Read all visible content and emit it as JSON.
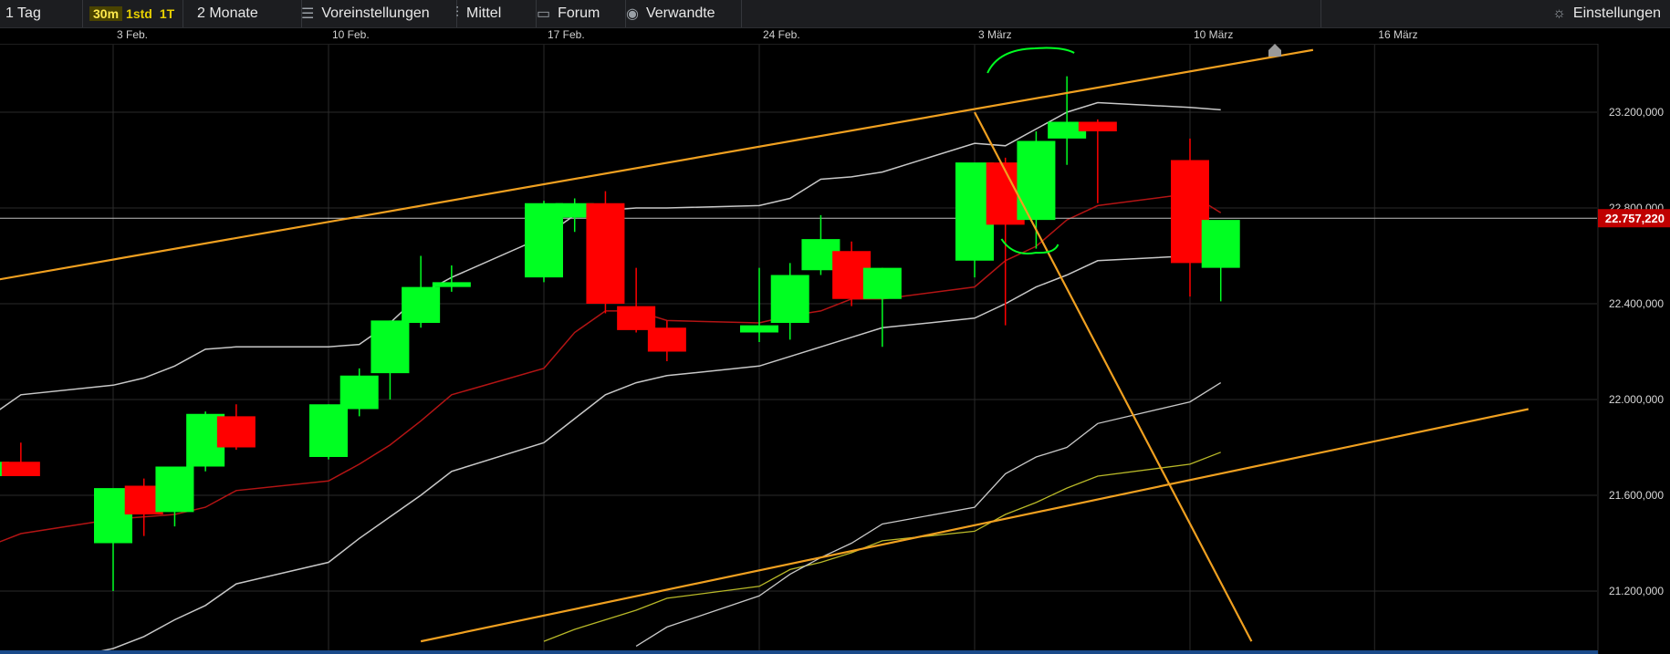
{
  "toolbar": {
    "range_label": "1 Tag",
    "intervals": [
      "30m",
      "1std",
      "1T"
    ],
    "active_interval": "30m",
    "period_label": "2 Monate",
    "presets_label": "Voreinstellungen",
    "indicator_label": "Mittel",
    "forum_label": "Forum",
    "related_label": "Verwandte",
    "settings_label": "Einstellungen",
    "icons": [
      "sliders-icon",
      "candles-icon",
      "chat-icon",
      "eye-icon",
      "gear-icon"
    ]
  },
  "colors": {
    "up": "#00ff22",
    "down": "#ff0000",
    "trendline": "#f0a020",
    "band": "#c8c8c8",
    "mid": "#b31414",
    "ma_yellow": "#b8b828",
    "grid": "#2a2a2a",
    "last_price_bg": "#c00000"
  },
  "chart_data": {
    "type": "candlestick",
    "x_ticks": [
      {
        "date": "2025-02-03",
        "label": "3 Feb."
      },
      {
        "date": "2025-02-10",
        "label": "10 Feb."
      },
      {
        "date": "2025-02-17",
        "label": "17 Feb."
      },
      {
        "date": "2025-02-24",
        "label": "24 Feb."
      },
      {
        "date": "2025-03-03",
        "label": "3 März"
      },
      {
        "date": "2025-03-10",
        "label": "10 März"
      },
      {
        "date": "2025-03-16",
        "label": "16 März"
      }
    ],
    "y_ticks": [
      21200,
      21600,
      22000,
      22400,
      22800,
      23200
    ],
    "y_tick_labels": [
      "21.200,000",
      "21.600,000",
      "22.000,000",
      "22.400,000",
      "22.800,000",
      "23.200,000"
    ],
    "ylim": [
      20990,
      23420
    ],
    "grid": true,
    "last_price": 22757.22,
    "last_price_label": "22.757,220",
    "candles": [
      {
        "date": "2025-01-30",
        "o": 21680,
        "h": 21860,
        "l": 21660,
        "c": 21740
      },
      {
        "date": "2025-01-31",
        "o": 21740,
        "h": 21820,
        "l": 21680,
        "c": 21680
      },
      {
        "date": "2025-02-03",
        "o": 21400,
        "h": 21590,
        "l": 21200,
        "c": 21630
      },
      {
        "date": "2025-02-04",
        "o": 21640,
        "h": 21670,
        "l": 21430,
        "c": 21520
      },
      {
        "date": "2025-02-05",
        "o": 21530,
        "h": 21720,
        "l": 21470,
        "c": 21720
      },
      {
        "date": "2025-02-06",
        "o": 21720,
        "h": 21950,
        "l": 21700,
        "c": 21940
      },
      {
        "date": "2025-02-07",
        "o": 21930,
        "h": 21980,
        "l": 21790,
        "c": 21800
      },
      {
        "date": "2025-02-10",
        "o": 21760,
        "h": 21980,
        "l": 21750,
        "c": 21980
      },
      {
        "date": "2025-02-11",
        "o": 21960,
        "h": 22130,
        "l": 21930,
        "c": 22100
      },
      {
        "date": "2025-02-12",
        "o": 22110,
        "h": 22330,
        "l": 22000,
        "c": 22330
      },
      {
        "date": "2025-02-13",
        "o": 22320,
        "h": 22600,
        "l": 22300,
        "c": 22470
      },
      {
        "date": "2025-02-14",
        "o": 22470,
        "h": 22560,
        "l": 22450,
        "c": 22490
      },
      {
        "date": "2025-02-17",
        "o": 22510,
        "h": 22830,
        "l": 22490,
        "c": 22820
      },
      {
        "date": "2025-02-18",
        "o": 22760,
        "h": 22840,
        "l": 22700,
        "c": 22820
      },
      {
        "date": "2025-02-19",
        "o": 22820,
        "h": 22870,
        "l": 22360,
        "c": 22400
      },
      {
        "date": "2025-02-20",
        "o": 22390,
        "h": 22550,
        "l": 22280,
        "c": 22290
      },
      {
        "date": "2025-02-21",
        "o": 22300,
        "h": 22330,
        "l": 22160,
        "c": 22200
      },
      {
        "date": "2025-02-24",
        "o": 22280,
        "h": 22550,
        "l": 22240,
        "c": 22310
      },
      {
        "date": "2025-02-25",
        "o": 22320,
        "h": 22570,
        "l": 22250,
        "c": 22520
      },
      {
        "date": "2025-02-26",
        "o": 22540,
        "h": 22770,
        "l": 22520,
        "c": 22670
      },
      {
        "date": "2025-02-27",
        "o": 22620,
        "h": 22660,
        "l": 22390,
        "c": 22420
      },
      {
        "date": "2025-02-28",
        "o": 22420,
        "h": 22550,
        "l": 22220,
        "c": 22550
      },
      {
        "date": "2025-03-03",
        "o": 22580,
        "h": 22980,
        "l": 22510,
        "c": 22990
      },
      {
        "date": "2025-03-04",
        "o": 22990,
        "h": 23010,
        "l": 22310,
        "c": 22730
      },
      {
        "date": "2025-03-05",
        "o": 22750,
        "h": 23120,
        "l": 22630,
        "c": 23080
      },
      {
        "date": "2025-03-06",
        "o": 23090,
        "h": 23350,
        "l": 22980,
        "c": 23160
      },
      {
        "date": "2025-03-07",
        "o": 23160,
        "h": 23170,
        "l": 22820,
        "c": 23120
      },
      {
        "date": "2025-03-10",
        "o": 23000,
        "h": 23090,
        "l": 22430,
        "c": 22570
      },
      {
        "date": "2025-03-11",
        "o": 22550,
        "h": 22740,
        "l": 22410,
        "c": 22750
      }
    ],
    "overlays": {
      "upper_band": [
        21930,
        22020,
        22060,
        22090,
        22140,
        22210,
        22220,
        22220,
        22230,
        22320,
        22440,
        22510,
        22680,
        22770,
        22790,
        22800,
        22800,
        22810,
        22840,
        22920,
        22930,
        22950,
        23070,
        23060,
        23130,
        23200,
        23240,
        23220,
        23210
      ],
      "middle_band": [
        21390,
        21440,
        21500,
        21510,
        21520,
        21550,
        21620,
        21660,
        21730,
        21810,
        21910,
        22020,
        22130,
        22280,
        22370,
        22370,
        22330,
        22320,
        22350,
        22370,
        22420,
        22420,
        22470,
        22580,
        22640,
        22750,
        22810,
        22860,
        22780
      ],
      "lower_band": [
        20850,
        20880,
        20960,
        21010,
        21080,
        21140,
        21230,
        21320,
        21420,
        21510,
        21600,
        21700,
        21820,
        21920,
        22020,
        22070,
        22100,
        22140,
        22180,
        22220,
        22260,
        22300,
        22340,
        22400,
        22470,
        22520,
        22580,
        22600,
        22650
      ],
      "ma_fast": [
        null,
        null,
        null,
        null,
        null,
        null,
        null,
        null,
        null,
        null,
        null,
        null,
        null,
        null,
        null,
        20970,
        21050,
        21180,
        21270,
        21340,
        21400,
        21480,
        21550,
        21690,
        21760,
        21800,
        21900,
        21990,
        22070
      ],
      "ma_slow": [
        null,
        null,
        null,
        null,
        null,
        null,
        null,
        null,
        null,
        null,
        null,
        null,
        20990,
        21040,
        21080,
        21120,
        21170,
        21220,
        21290,
        21320,
        21360,
        21410,
        21450,
        21520,
        21570,
        21630,
        21680,
        21730,
        21780
      ]
    },
    "trendlines": [
      {
        "from": {
          "date": "2025-01-28",
          "value": 22450
        },
        "to": {
          "date": "2025-03-14",
          "value": 23460
        }
      },
      {
        "from": {
          "date": "2025-02-13",
          "value": 20990
        },
        "to": {
          "date": "2025-03-21",
          "value": 21960
        }
      },
      {
        "from": {
          "date": "2025-03-03",
          "value": 23200
        },
        "to": {
          "date": "2025-03-12",
          "value": 20990
        }
      }
    ],
    "annotations": [
      {
        "type": "arc",
        "near": "2025-03-06",
        "position": "above"
      },
      {
        "type": "arc",
        "near": "2025-03-05",
        "position": "below"
      }
    ]
  }
}
